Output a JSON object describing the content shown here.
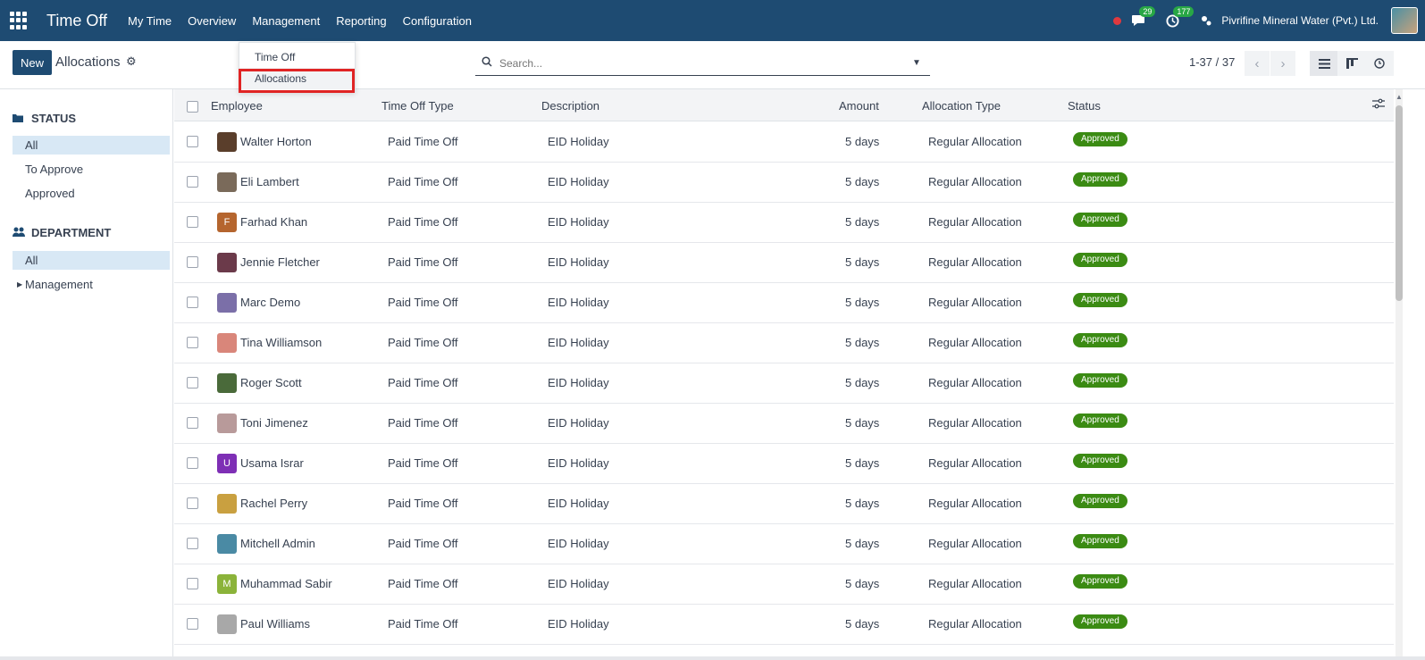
{
  "app": {
    "title": "Time Off",
    "menu": [
      "My Time",
      "Overview",
      "Management",
      "Reporting",
      "Configuration"
    ],
    "company": "Pivrifine Mineral Water (Pvt.) Ltd.",
    "chat_count": "29",
    "activity_count": "177",
    "icons": [
      "apps-grid-icon",
      "record-dot-icon",
      "chat-icon",
      "clock-icon",
      "switch-company-icon",
      "user-avatar"
    ]
  },
  "dropdown": {
    "items": [
      "Time Off",
      "Allocations"
    ],
    "highlighted": "Allocations"
  },
  "control": {
    "new_label": "New",
    "breadcrumb": "Allocations",
    "search_placeholder": "Search...",
    "pager": "1-37 / 37"
  },
  "sidebar": {
    "status_title": "STATUS",
    "status_items": [
      "All",
      "To Approve",
      "Approved"
    ],
    "department_title": "DEPARTMENT",
    "department_items": [
      "All",
      "Management"
    ]
  },
  "table": {
    "columns": [
      "Employee",
      "Time Off Type",
      "Description",
      "Amount",
      "Allocation Type",
      "Status"
    ],
    "rows": [
      {
        "employee": "Walter Horton",
        "type": "Paid Time Off",
        "description": "EID Holiday",
        "amount": "5 days",
        "alloc": "Regular Allocation",
        "status": "Approved",
        "avatar": "",
        "color": "#5a3e2b"
      },
      {
        "employee": "Eli Lambert",
        "type": "Paid Time Off",
        "description": "EID Holiday",
        "amount": "5 days",
        "alloc": "Regular Allocation",
        "status": "Approved",
        "avatar": "",
        "color": "#7a6a5a"
      },
      {
        "employee": "Farhad Khan",
        "type": "Paid Time Off",
        "description": "EID Holiday",
        "amount": "5 days",
        "alloc": "Regular Allocation",
        "status": "Approved",
        "avatar": "F",
        "color": "#b5652e"
      },
      {
        "employee": "Jennie Fletcher",
        "type": "Paid Time Off",
        "description": "EID Holiday",
        "amount": "5 days",
        "alloc": "Regular Allocation",
        "status": "Approved",
        "avatar": "",
        "color": "#6b3a4a"
      },
      {
        "employee": "Marc Demo",
        "type": "Paid Time Off",
        "description": "EID Holiday",
        "amount": "5 days",
        "alloc": "Regular Allocation",
        "status": "Approved",
        "avatar": "",
        "color": "#7b6fa8"
      },
      {
        "employee": "Tina Williamson",
        "type": "Paid Time Off",
        "description": "EID Holiday",
        "amount": "5 days",
        "alloc": "Regular Allocation",
        "status": "Approved",
        "avatar": "",
        "color": "#d9867a"
      },
      {
        "employee": "Roger Scott",
        "type": "Paid Time Off",
        "description": "EID Holiday",
        "amount": "5 days",
        "alloc": "Regular Allocation",
        "status": "Approved",
        "avatar": "",
        "color": "#4a6a3a"
      },
      {
        "employee": "Toni Jimenez",
        "type": "Paid Time Off",
        "description": "EID Holiday",
        "amount": "5 days",
        "alloc": "Regular Allocation",
        "status": "Approved",
        "avatar": "",
        "color": "#b89a9a"
      },
      {
        "employee": "Usama Israr",
        "type": "Paid Time Off",
        "description": "EID Holiday",
        "amount": "5 days",
        "alloc": "Regular Allocation",
        "status": "Approved",
        "avatar": "U",
        "color": "#7e2fb5"
      },
      {
        "employee": "Rachel Perry",
        "type": "Paid Time Off",
        "description": "EID Holiday",
        "amount": "5 days",
        "alloc": "Regular Allocation",
        "status": "Approved",
        "avatar": "",
        "color": "#c9a040"
      },
      {
        "employee": "Mitchell Admin",
        "type": "Paid Time Off",
        "description": "EID Holiday",
        "amount": "5 days",
        "alloc": "Regular Allocation",
        "status": "Approved",
        "avatar": "",
        "color": "#4a8aa4"
      },
      {
        "employee": "Muhammad Sabir",
        "type": "Paid Time Off",
        "description": "EID Holiday",
        "amount": "5 days",
        "alloc": "Regular Allocation",
        "status": "Approved",
        "avatar": "M",
        "color": "#8bb33a"
      },
      {
        "employee": "Paul Williams",
        "type": "Paid Time Off",
        "description": "EID Holiday",
        "amount": "5 days",
        "alloc": "Regular Allocation",
        "status": "Approved",
        "avatar": "",
        "color": "#a8a8a8"
      }
    ]
  },
  "colors": {
    "navbar": "#1e4b72",
    "approved_badge": "#3b8b13",
    "highlight_box": "#e02424"
  }
}
